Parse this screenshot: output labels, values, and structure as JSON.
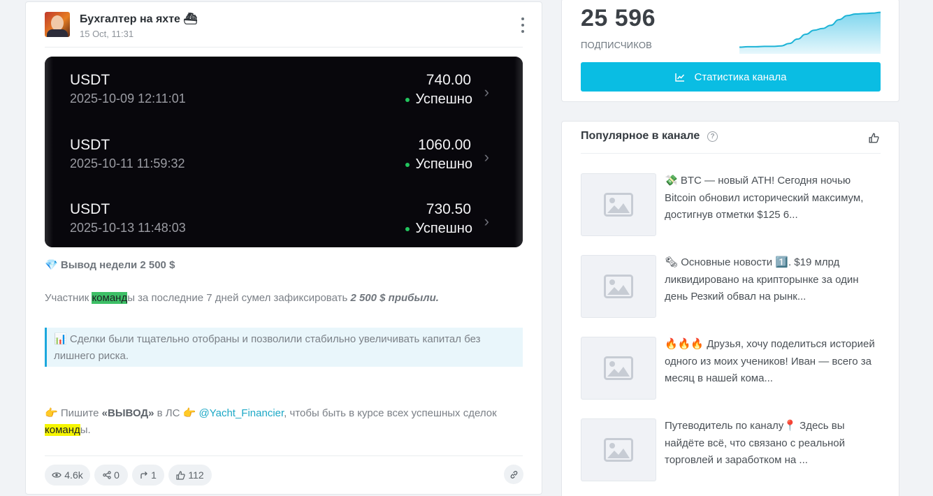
{
  "post": {
    "channel_name": "Бухгалтер на яхте",
    "channel_emoji": "⛴",
    "date": "15 Oct, 11:31",
    "image": {
      "transactions": [
        {
          "asset": "USDT",
          "time": "2025-10-09 12:11:01",
          "amount": "740.00",
          "status": "Успешно"
        },
        {
          "asset": "USDT",
          "time": "2025-10-11 11:59:32",
          "amount": "1060.00",
          "status": "Успешно"
        },
        {
          "asset": "USDT",
          "time": "2025-10-13 11:48:03",
          "amount": "730.50",
          "status": "Успешно"
        }
      ]
    },
    "title_emoji": "💎",
    "title": "Вывод недели 2 500 $",
    "body": {
      "prefix": "Участник ",
      "highlight": "команд",
      "middle": "ы за последние 7 дней сумел зафиксировать ",
      "bold": "2 500 $ прибыли."
    },
    "quote_emoji": "📊",
    "quote": "Сделки были тщательно отобраны и позволили стабильно увеличивать капитал без лишнего риска.",
    "cta": {
      "emoji": "👉",
      "prefix": " Пишите ",
      "bold": "«ВЫВОД»",
      "middle": " в ЛС ",
      "mention": "@Yacht_Financier",
      "suffix": ", чтобы быть в курсе всех успешных сделок ",
      "highlight": "команд",
      "end": "ы."
    },
    "stats": {
      "views": "4.6k",
      "shares": "0",
      "forwards": "1",
      "likes": "112"
    }
  },
  "subscribers": {
    "count": "25 596",
    "label": "ПОДПИСЧИКОВ",
    "button_label": "Статистика канала",
    "trend": [
      0.06,
      0.07,
      0.07,
      0.08,
      0.08,
      0.09,
      0.15,
      0.26,
      0.38,
      0.48,
      0.52,
      0.6,
      0.74,
      0.84,
      0.88,
      0.89,
      0.9,
      0.92
    ]
  },
  "popular": {
    "title": "Популярное в канале",
    "items": [
      {
        "emoji": "💸",
        "text": " BTC — новый ATH! Сегодня ночью Bitcoin обновил исторический максимум, достигнув отметки $125 6..."
      },
      {
        "emoji": "🗞",
        "text": " Основные новости ",
        "emoji2": "1️⃣",
        "text2": ". $19 млрд ликвидировано на крипторынке за один день Резкий обвал на рынк..."
      },
      {
        "emoji": "🔥🔥🔥",
        "text": " Друзья, хочу поделиться историей одного из моих учеников! Иван — всего за месяц в нашей кома..."
      },
      {
        "emoji": "",
        "text": "Путеводитель по каналу",
        "emoji2": "📍",
        "text2": " Здесь вы найдёте всё, что связано с реальной торговлей и заработком на ..."
      }
    ]
  },
  "colors": {
    "accent": "#0abde3",
    "mention": "#1ca8c6",
    "success": "#22c55e",
    "highlight_green": "#3dbf66",
    "highlight_yellow": "#f5f500"
  }
}
